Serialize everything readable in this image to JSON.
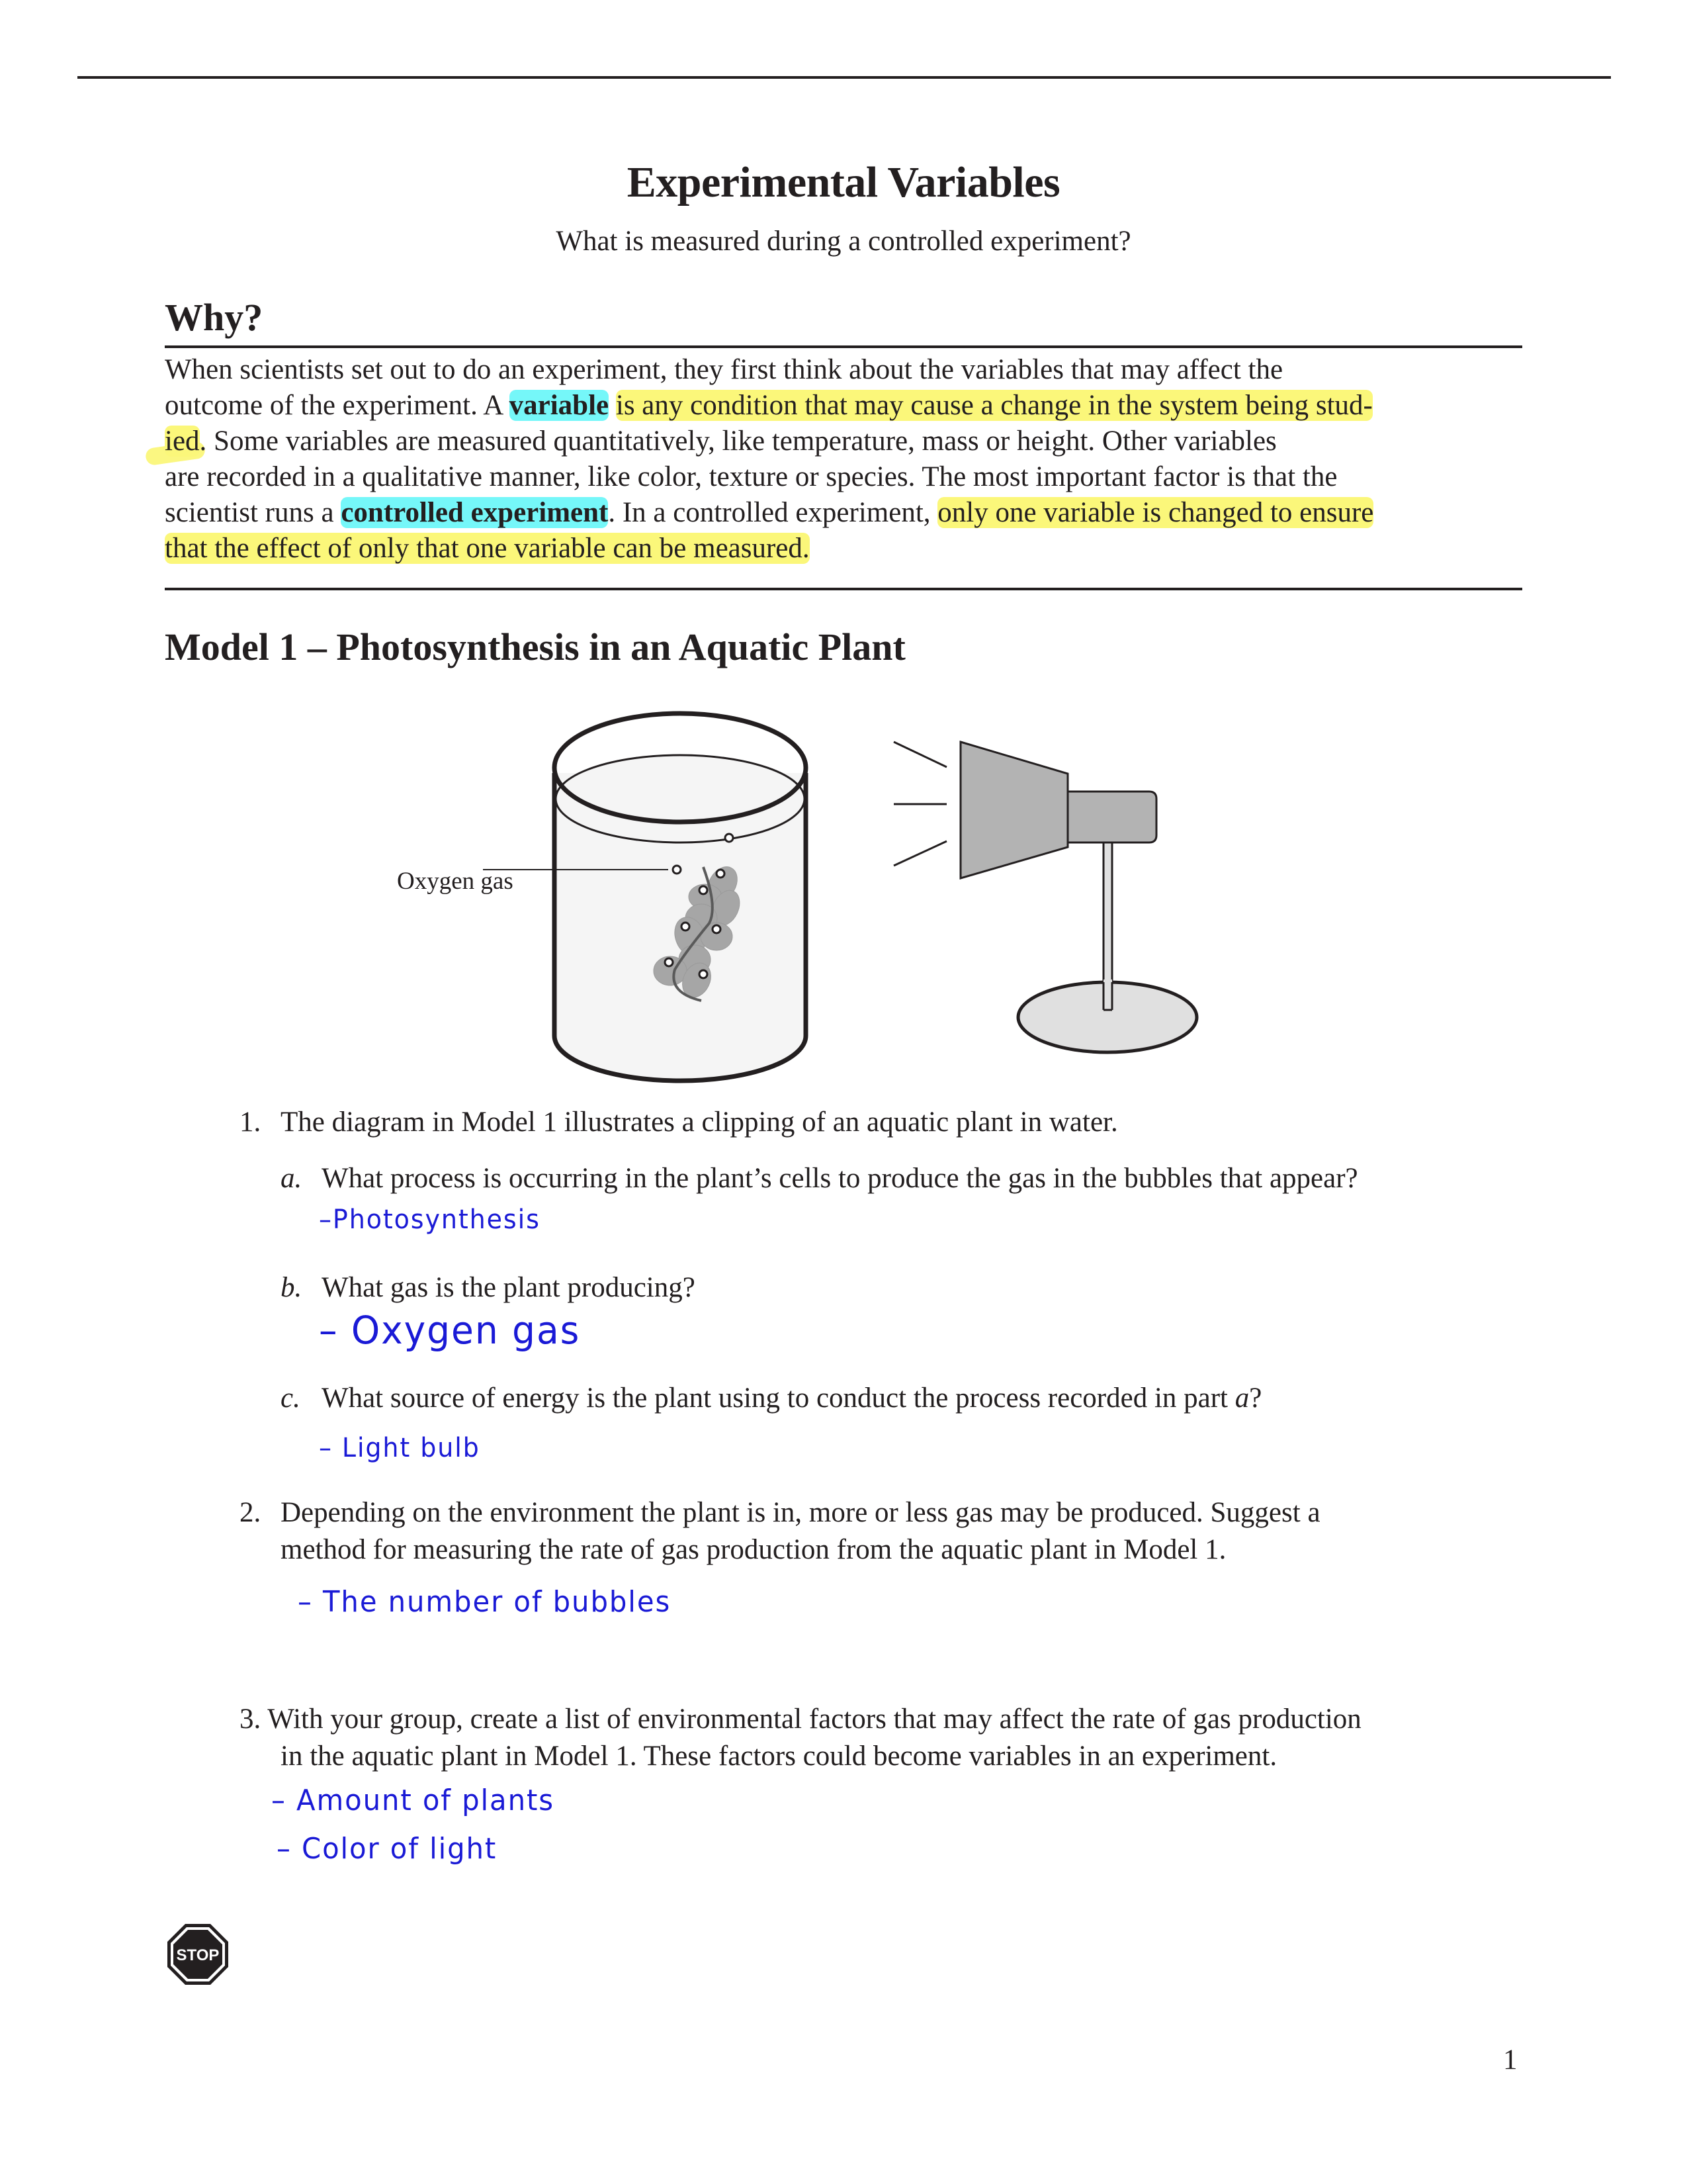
{
  "page": {
    "title": "Experimental Variables",
    "subtitle": "What is measured during a controlled experiment?",
    "page_number": "1"
  },
  "why": {
    "heading": "Why?",
    "lines": [
      [
        {
          "t": "When scientists set out to do an experiment, they first think about the variables that may affect the",
          "s": ""
        }
      ],
      [
        {
          "t": "outcome of the experiment. A ",
          "s": ""
        },
        {
          "t": "variable",
          "s": "cyan"
        },
        {
          "t": " ",
          "s": ""
        },
        {
          "t": "is any condition that may cause a change in the system being stud-",
          "s": "yellow"
        }
      ],
      [
        {
          "t": "ied",
          "s": "yellow"
        },
        {
          "t": ". Some variables are measured quantitatively, like temperature, mass or height. Other variables",
          "s": ""
        }
      ],
      [
        {
          "t": "are recorded in a qualitative manner, like color, texture or species. The most important factor is that the",
          "s": ""
        }
      ],
      [
        {
          "t": "scientist runs a ",
          "s": ""
        },
        {
          "t": "controlled experiment",
          "s": "cyan"
        },
        {
          "t": ". In a controlled experiment, ",
          "s": ""
        },
        {
          "t": "only one variable is changed to ensure",
          "s": "yellow"
        }
      ],
      [
        {
          "t": "that the effect of only that one variable can be measured.",
          "s": "yellow"
        }
      ]
    ]
  },
  "highlight_colors": {
    "yellow": "#fbf77a",
    "cyan": "#75f7f9",
    "handwriting": "#1a1ad6"
  },
  "model": {
    "heading": "Model 1 – Photosynthesis in an Aquatic Plant",
    "label_oxygen": "Oxygen gas",
    "icons": [
      "beaker-icon",
      "aquatic-plant-icon",
      "lamp-icon",
      "light-rays-icon"
    ]
  },
  "questions": {
    "q1": {
      "num": "1.",
      "text": "The diagram in Model 1 illustrates a clipping of an aquatic plant in water.",
      "a": {
        "label": "a.",
        "text": "What process is occurring in the plant’s cells to produce the gas in the bubbles that appear?",
        "answer": "–Photosynthesis"
      },
      "b": {
        "label": "b.",
        "text": "What gas is the plant producing?",
        "answer": "– Oxygen gas"
      },
      "c": {
        "label": "c.",
        "text_pre": "What source of energy is the plant using to conduct the process recorded in part ",
        "text_ital": "a",
        "text_post": "?",
        "answer": "– Light bulb"
      }
    },
    "q2": {
      "num": "2.",
      "line1": "Depending on the environment the plant is in, more or less gas may be produced. Suggest a",
      "line2": "method for measuring the rate of gas production from the aquatic plant in Model 1.",
      "answer": "– The number of bubbles"
    },
    "q3": {
      "num": "3.",
      "line1": "With your group, create a list of environmental factors that may affect the rate of gas production",
      "line2": "in the aquatic plant in Model 1. These factors could become variables in an experiment.",
      "answers": [
        "– Amount of plants",
        "– Color of light"
      ]
    }
  },
  "stop_sign": {
    "label": "STOP"
  }
}
